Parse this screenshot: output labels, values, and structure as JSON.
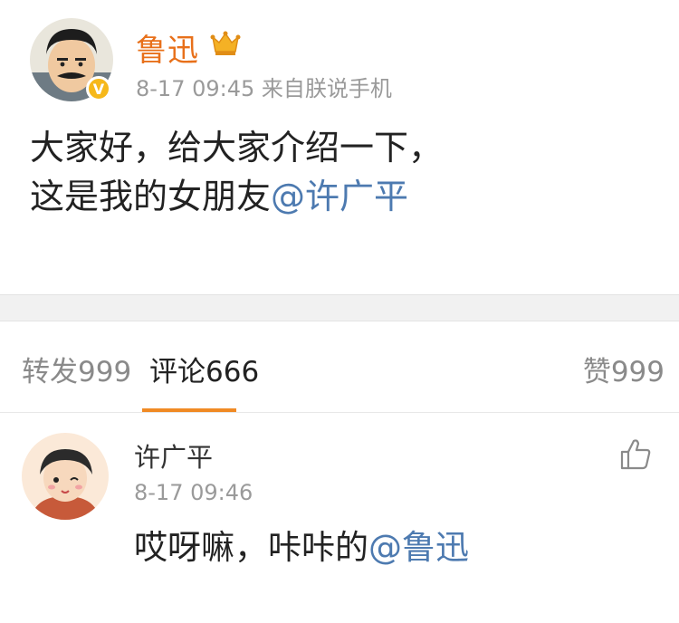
{
  "post": {
    "author": "鲁迅",
    "meta": "8-17 09:45 来自朕说手机",
    "body_line1": "大家好，给大家介绍一下，",
    "body_line2_text": "这是我的女朋友",
    "body_line2_mention": "@许广平",
    "verified_badge": "V",
    "badge_icon": "crown-vip-icon",
    "verified_icon": "verified-check-icon"
  },
  "tabs": {
    "repost": "转发999",
    "comment": "评论666",
    "like": "赞999"
  },
  "comment": {
    "author": "许广平",
    "time": "8-17 09:46",
    "body_text": "哎呀嘛，咔咔的",
    "body_mention": "@鲁迅",
    "like_icon": "thumbs-up-icon"
  },
  "colors": {
    "author_name": "#e8701a",
    "mention": "#4d7ab0",
    "tab_underline": "#f08a24",
    "secondary_text": "#9a9a9a"
  }
}
